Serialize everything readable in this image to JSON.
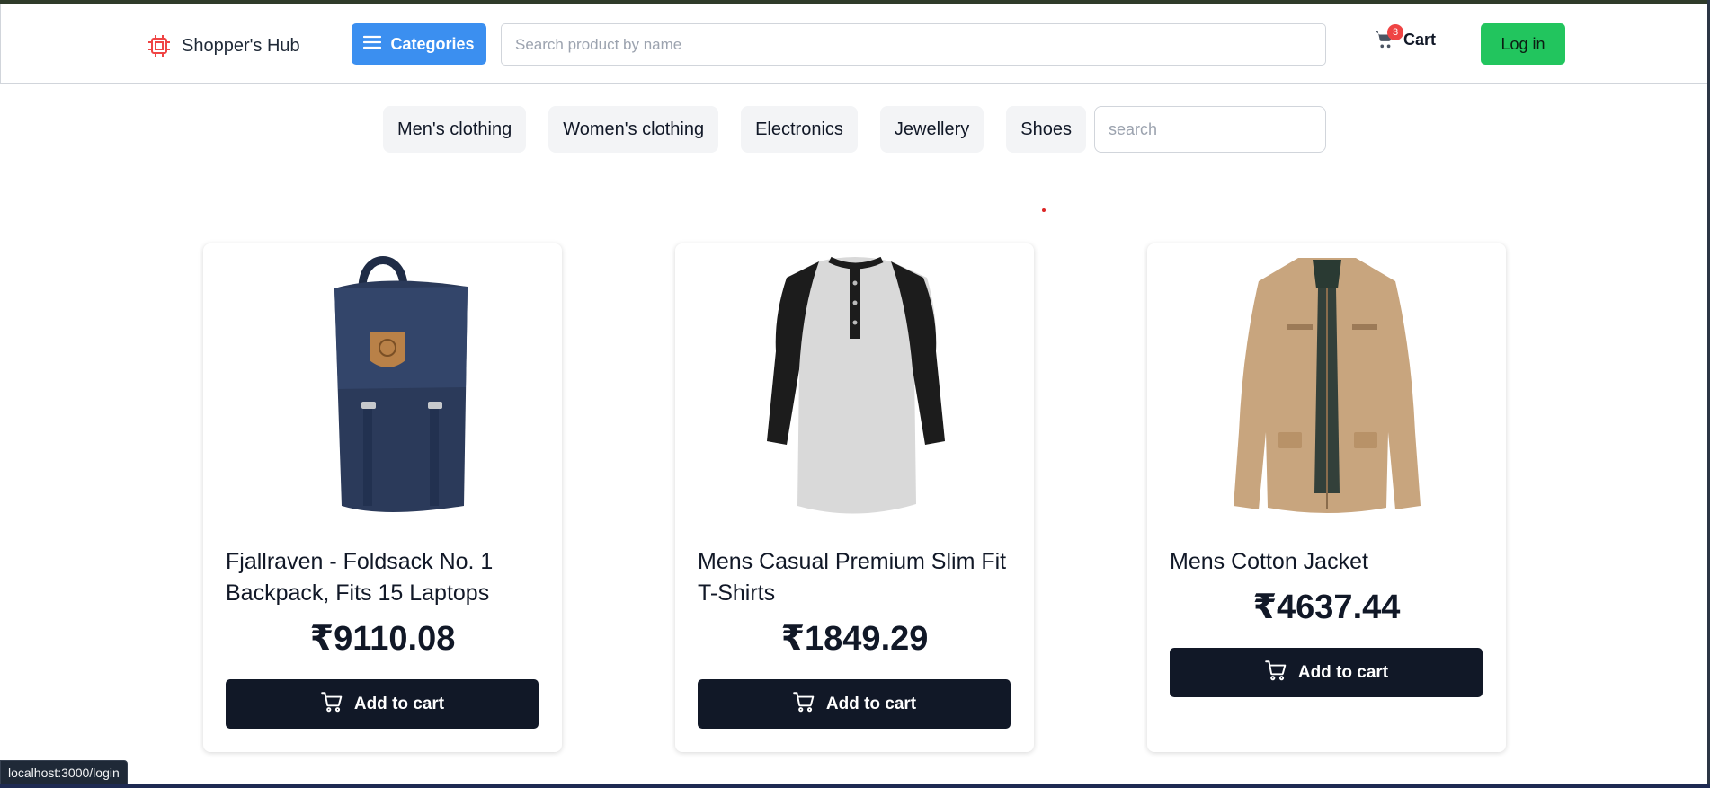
{
  "header": {
    "brand": "Shopper's Hub",
    "categories_label": "Categories",
    "search_placeholder": "Search product by name",
    "cart_label": "Cart",
    "cart_count": "3",
    "login_label": "Log in"
  },
  "filters": {
    "chips": [
      "Men's clothing",
      "Women's clothing",
      "Electronics",
      "Jewellery",
      "Shoes"
    ],
    "search_placeholder": "search"
  },
  "products": [
    {
      "title": "Fjallraven - Foldsack No. 1 Backpack, Fits 15 Laptops",
      "price": "₹9110.08",
      "button": "Add to cart"
    },
    {
      "title": "Mens Casual Premium Slim Fit T-Shirts",
      "price": "₹1849.29",
      "button": "Add to cart"
    },
    {
      "title": "Mens Cotton Jacket",
      "price": "₹4637.44",
      "button": "Add to cart"
    }
  ],
  "status_bar": {
    "url": "localhost:3000/login"
  },
  "colors": {
    "categories_button": "#3b8ff0",
    "login_button": "#22c55e",
    "add_to_cart_button": "#111827",
    "cart_badge": "#ef4444",
    "brand_icon": "#ef4444"
  },
  "icons": [
    "chip-icon",
    "menu-icon",
    "cart-icon",
    "shopping-cart-icon"
  ]
}
